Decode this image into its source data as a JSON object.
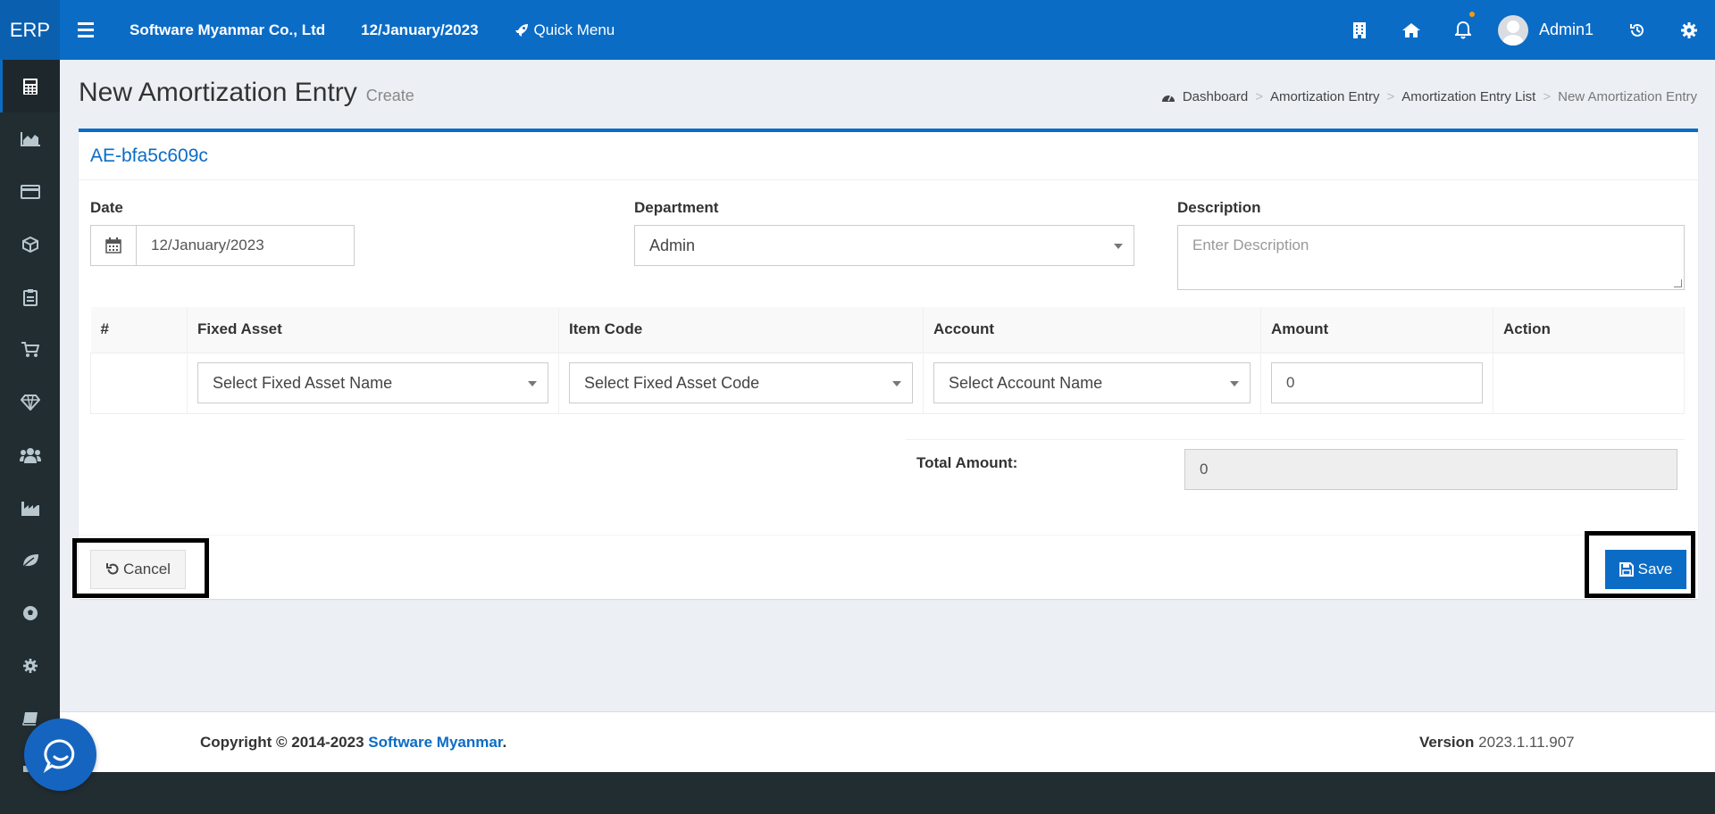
{
  "topbar": {
    "brand": "ERP",
    "company": "Software Myanmar Co., Ltd",
    "date": "12/January/2023",
    "quick_menu": "Quick Menu",
    "username": "Admin1"
  },
  "page": {
    "title": "New Amortization Entry",
    "subtitle": "Create"
  },
  "breadcrumb": {
    "dashboard": "Dashboard",
    "entry": "Amortization Entry",
    "list": "Amortization Entry List",
    "current": "New Amortization Entry",
    "separator": ">"
  },
  "form": {
    "code": "AE-bfa5c609c",
    "date_label": "Date",
    "date_value": "12/January/2023",
    "department_label": "Department",
    "department_value": "Admin",
    "description_label": "Description",
    "description_placeholder": "Enter Description"
  },
  "table": {
    "headers": [
      "#",
      "Fixed Asset",
      "Item Code",
      "Account",
      "Amount",
      "Action"
    ],
    "row": {
      "fixed_asset": "Select Fixed Asset Name",
      "item_code": "Select Fixed Asset Code",
      "account": "Select Account Name",
      "amount": "0"
    }
  },
  "total": {
    "label": "Total Amount:",
    "value": "0"
  },
  "buttons": {
    "cancel": "Cancel",
    "save": "Save"
  },
  "footer": {
    "copyright": "Copyright © 2014-2023",
    "company_link": "Software Myanmar",
    "period": ".",
    "version_label": "Version",
    "version_value": "2023.1.11.907"
  },
  "colors": {
    "primary": "#0b6cc6",
    "sidebar": "#222d32",
    "background": "#ecf0f5"
  },
  "icons": {
    "sidebar": [
      "calculator-icon",
      "area-chart-icon",
      "credit-card-icon",
      "cube-icon",
      "clipboard-icon",
      "cart-icon",
      "diamond-icon",
      "users-icon",
      "industry-icon",
      "leaf-icon",
      "soccer-ball-icon",
      "gear-icon",
      "book-icon",
      "comment-icon"
    ]
  }
}
